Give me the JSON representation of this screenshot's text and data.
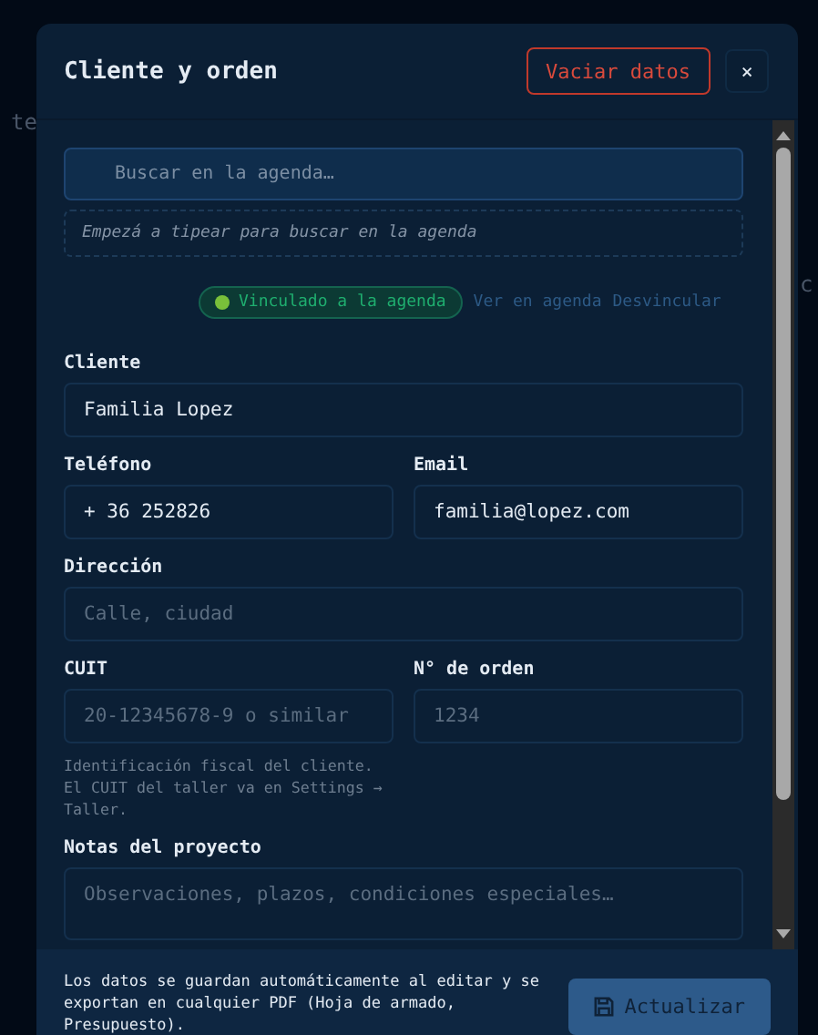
{
  "background": {
    "fragments": [
      "te",
      "c"
    ]
  },
  "dialog": {
    "title": "Cliente y orden",
    "clear_button": "Vaciar datos",
    "close_button": "×"
  },
  "search": {
    "placeholder": "Buscar en la agenda…",
    "hint": "Empezá a tipear para buscar en la agenda"
  },
  "link_status": {
    "linked": true,
    "badge": "Vinculado a la agenda",
    "actions": [
      "Ver en agenda",
      "Desvincular"
    ]
  },
  "fields": [
    {
      "label": "Cliente",
      "value": "Familia Lopez",
      "kind": "wide"
    },
    {
      "label": "Teléfono",
      "value": "+ 36 252826",
      "kind": "narrow"
    },
    {
      "label": "Email",
      "value": "familia@lopez.com",
      "kind": "narrow"
    },
    {
      "label": "Dirección",
      "placeholder": "Calle, ciudad",
      "kind": "wide"
    },
    {
      "label": "CUIT",
      "placeholder": "20-12345678-9 o similar",
      "kind": "narrow",
      "help": "Identificación fiscal del cliente. El CUIT del taller va en Settings → Taller."
    },
    {
      "label": "N° de orden",
      "placeholder": "1234",
      "kind": "narrow"
    }
  ],
  "notes": {
    "label": "Notas del proyecto",
    "placeholder": "Observaciones, plazos, condiciones especiales…"
  },
  "footer": {
    "text": "Los datos se guardan automáticamente al editar y se exportan en cualquier PDF (Hoja de armado, Presupuesto).",
    "button": "Actualizar"
  }
}
